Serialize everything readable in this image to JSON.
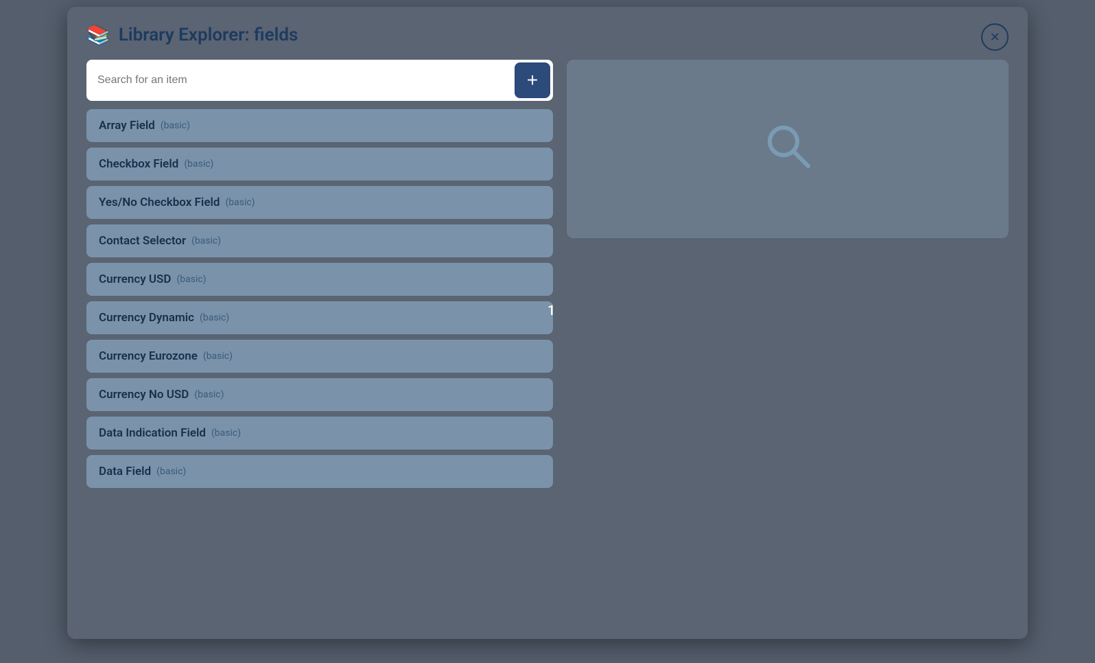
{
  "modal": {
    "title": "Library Explorer: fields",
    "close_label": "✕"
  },
  "search": {
    "placeholder": "Search for an item"
  },
  "add_button": {
    "label": "+"
  },
  "items": [
    {
      "name": "Array Field",
      "badge": "(basic)"
    },
    {
      "name": "Checkbox Field",
      "badge": "(basic)"
    },
    {
      "name": "Yes/No Checkbox Field",
      "badge": "(basic)"
    },
    {
      "name": "Contact Selector",
      "badge": "(basic)"
    },
    {
      "name": "Currency USD",
      "badge": "(basic)"
    },
    {
      "name": "Currency Dynamic",
      "badge": "(basic)"
    },
    {
      "name": "Currency Eurozone",
      "badge": "(basic)"
    },
    {
      "name": "Currency No USD",
      "badge": "(basic)"
    },
    {
      "name": "Data Indication Field",
      "badge": "(basic)"
    },
    {
      "name": "Data Field",
      "badge": "(basic)"
    }
  ],
  "page_number": "1",
  "colors": {
    "title": "#1e3a5f",
    "item_bg": "#7a93aa",
    "add_bg": "#2c4a7a",
    "preview_bg": "#6b7a8a"
  }
}
